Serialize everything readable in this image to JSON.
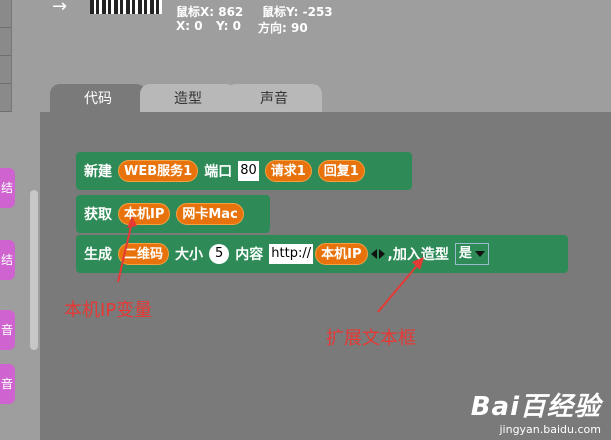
{
  "coords": {
    "mouse_x": "鼠标X: 862",
    "mouse_y": "鼠标Y: -253",
    "x": "X: 0",
    "y": "Y: 0",
    "direction": "方向: 90"
  },
  "tabs": [
    {
      "label": "代码",
      "active": true
    },
    {
      "label": "造型",
      "active": false
    },
    {
      "label": "声音",
      "active": false
    }
  ],
  "categories": [
    "结",
    "结",
    "音",
    "音"
  ],
  "blocks": {
    "create": {
      "label": "新建",
      "server": "WEB服务1",
      "port_label": "端口",
      "port": "80",
      "request": "请求1",
      "response": "回复1"
    },
    "get": {
      "label": "获取",
      "ip": "本机IP",
      "mac": "网卡Mac"
    },
    "generate": {
      "label": "生成",
      "qrcode": "二维码",
      "size_label": "大小",
      "size": "5",
      "content_label": "内容",
      "url": "http://",
      "ip": "本机IP",
      "add_label": ",加入造型",
      "choice": "是"
    }
  },
  "annotations": {
    "ip_var": "本机IP变量",
    "expand": "扩展文本框"
  },
  "watermark": {
    "logo": "Bai百经验",
    "url": "jingyan.baidu.com"
  },
  "colors": {
    "block_green": "#2e8b57",
    "pill_orange": "#e8730c",
    "annotation_red": "#e53935",
    "category_purple": "#cf63cf"
  }
}
